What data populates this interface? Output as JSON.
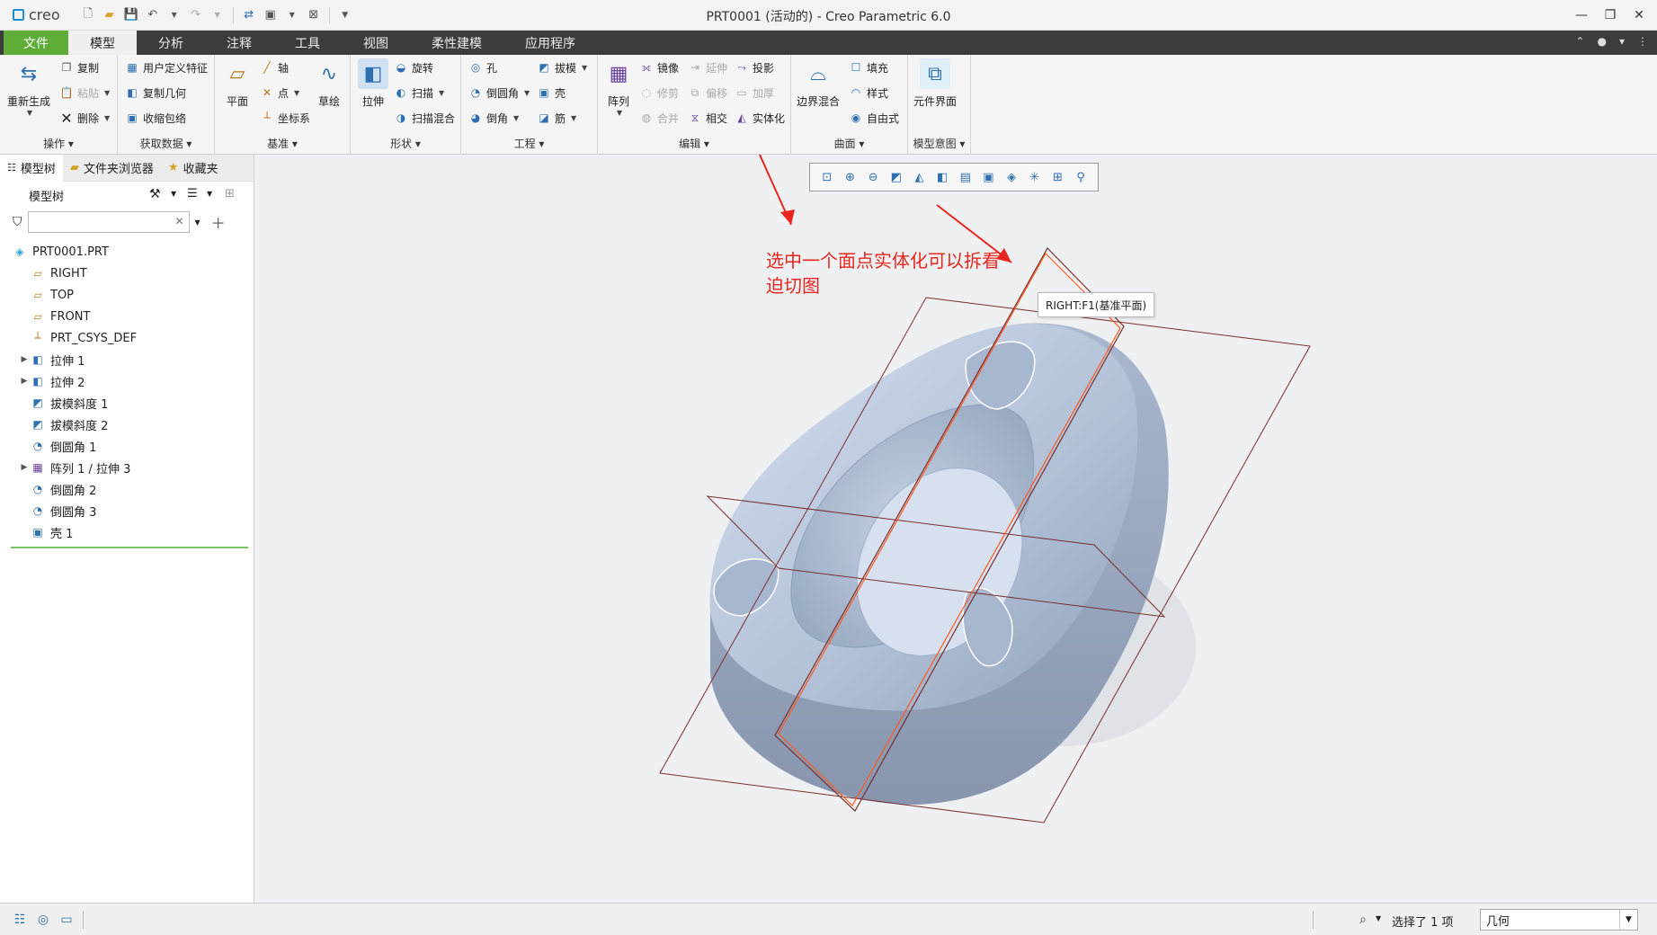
{
  "app": {
    "logo": "creo",
    "window_title": "PRT0001 (活动的) - Creo Parametric 6.0"
  },
  "tabs": [
    {
      "label": "文件"
    },
    {
      "label": "模型"
    },
    {
      "label": "分析"
    },
    {
      "label": "注释"
    },
    {
      "label": "工具"
    },
    {
      "label": "视图"
    },
    {
      "label": "柔性建模"
    },
    {
      "label": "应用程序"
    }
  ],
  "ribbon": {
    "operations": {
      "label": "操作",
      "regen": "重新生成",
      "copy": "复制",
      "paste": "粘贴",
      "delete": "删除"
    },
    "getdata": {
      "label": "获取数据",
      "udf": "用户定义特征",
      "copygeom": "复制几何",
      "shrinkwrap": "收缩包络"
    },
    "datum": {
      "label": "基准",
      "plane": "平面",
      "axis": "轴",
      "point": "点",
      "csys": "坐标系",
      "sketch": "草绘"
    },
    "shapes": {
      "label": "形状",
      "extrude": "拉伸",
      "revolve": "旋转",
      "sweep": "扫描",
      "sweptblend": "扫描混合"
    },
    "engineering": {
      "label": "工程",
      "hole": "孔",
      "round": "倒圆角",
      "chamfer": "倒角",
      "draft": "拔模",
      "shell": "壳",
      "rib": "筋"
    },
    "editing": {
      "label": "编辑",
      "pattern": "阵列",
      "mirror": "镜像",
      "extend": "延伸",
      "project": "投影",
      "trim": "修剪",
      "offset": "偏移",
      "thicken": "加厚",
      "merge": "合并",
      "intersect": "相交",
      "solidify": "实体化"
    },
    "surfaces": {
      "label": "曲面",
      "boundary": "边界混合",
      "fill": "填充",
      "style": "样式",
      "freestyle": "自由式"
    },
    "intent": {
      "label": "模型意图",
      "compinterface": "元件界面"
    }
  },
  "leftpanel": {
    "tabs": [
      {
        "label": "模型树"
      },
      {
        "label": "文件夹浏览器"
      },
      {
        "label": "收藏夹"
      }
    ],
    "tree_title": "模型树",
    "search_placeholder": "",
    "nodes": [
      {
        "label": "PRT0001.PRT"
      },
      {
        "label": "RIGHT"
      },
      {
        "label": "TOP"
      },
      {
        "label": "FRONT"
      },
      {
        "label": "PRT_CSYS_DEF"
      },
      {
        "label": "拉伸 1"
      },
      {
        "label": "拉伸 2"
      },
      {
        "label": "拔模斜度 1"
      },
      {
        "label": "拔模斜度 2"
      },
      {
        "label": "倒圆角 1"
      },
      {
        "label": "阵列 1 / 拉伸 3"
      },
      {
        "label": "倒圆角 2"
      },
      {
        "label": "倒圆角 3"
      },
      {
        "label": "壳 1"
      }
    ]
  },
  "viewport": {
    "tooltip": "RIGHT:F1(基准平面)",
    "annotation": "选中一个面点实体化可以拆看迫切图",
    "colors": {
      "part": "#b4c3d8",
      "datum_plane": "#7a2e2e",
      "highlight": "#ff5a1f",
      "annotation": "#e8261f"
    }
  },
  "status": {
    "selected": "选择了 1 项",
    "filter": "几何"
  }
}
